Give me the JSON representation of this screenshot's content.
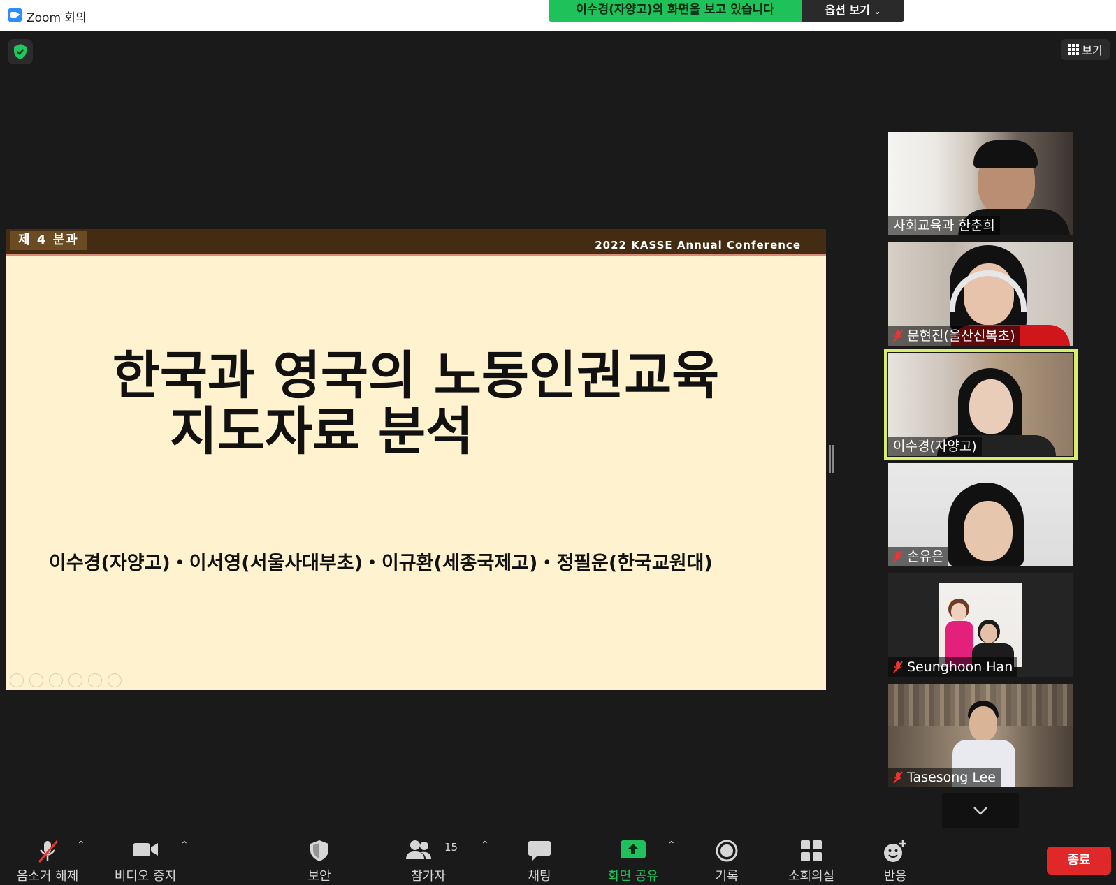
{
  "window": {
    "title": "Zoom 회의"
  },
  "share_banner": {
    "text": "이수경(자양고)의 화면을 보고 있습니다",
    "options_label": "옵션 보기",
    "color": "#1fc15a"
  },
  "view_button": {
    "label": "보기"
  },
  "slide": {
    "section": "제 4 분과",
    "conference": "2022 KASSE Annual Conference",
    "title_line1": "한국과 영국의 노동인권교육",
    "title_line2": "지도자료 분석",
    "authors": "이수경(자양고)・이서영(서울사대부초)・이규환(세종국제고)・정필운(한국교원대)"
  },
  "participants": [
    {
      "name": "사회교육과 한춘희",
      "muted": false
    },
    {
      "name": "문현진(울산신복초)",
      "muted": true
    },
    {
      "name": "이수경(자양고)",
      "muted": false,
      "active": true
    },
    {
      "name": "손유은",
      "muted": true
    },
    {
      "name": "Seunghoon Han",
      "muted": true
    },
    {
      "name": "Tasesong Lee",
      "muted": true
    }
  ],
  "toolbar": {
    "unmute": "음소거 해제",
    "stop_video": "비디오 중지",
    "security": "보안",
    "participants": "참가자",
    "participants_count": "15",
    "chat": "채팅",
    "share_screen": "화면 공유",
    "record": "기록",
    "breakout": "소회의실",
    "reactions": "반응",
    "end": "종료"
  },
  "colors": {
    "accent_green": "#1fc15a",
    "active_border": "#d8ef6e",
    "end_red": "#e02828",
    "zoom_blue": "#2d8cff"
  }
}
